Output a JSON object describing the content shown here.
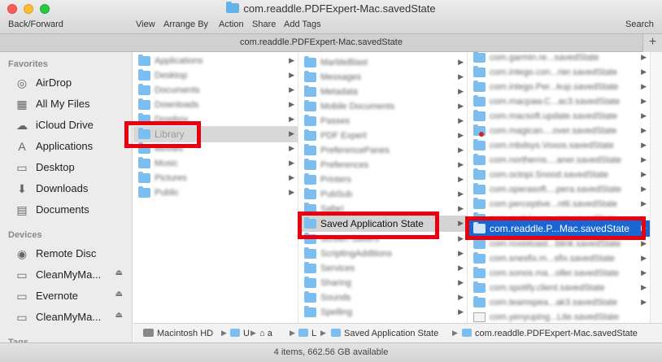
{
  "window": {
    "title": "com.readdle.PDFExpert-Mac.savedState"
  },
  "toolbar": {
    "back_forward": "Back/Forward",
    "view": "View",
    "arrange_by": "Arrange By",
    "action": "Action",
    "share": "Share",
    "add_tags": "Add Tags",
    "search": "Search"
  },
  "tabbar": {
    "title": "com.readdle.PDFExpert-Mac.savedState",
    "plus": "+"
  },
  "sidebar": {
    "favorites_heading": "Favorites",
    "favorites": [
      {
        "label": "AirDrop",
        "icon": "airdrop-icon"
      },
      {
        "label": "All My Files",
        "icon": "all-files-icon"
      },
      {
        "label": "iCloud Drive",
        "icon": "cloud-icon"
      },
      {
        "label": "Applications",
        "icon": "applications-icon"
      },
      {
        "label": "Desktop",
        "icon": "desktop-icon"
      },
      {
        "label": "Downloads",
        "icon": "downloads-icon"
      },
      {
        "label": "Documents",
        "icon": "documents-icon"
      }
    ],
    "devices_heading": "Devices",
    "devices": [
      {
        "label": "Remote Disc",
        "icon": "disc-icon"
      },
      {
        "label": "CleanMyMa...",
        "icon": "drive-icon"
      },
      {
        "label": "Evernote",
        "icon": "drive-icon"
      },
      {
        "label": "CleanMyMa...",
        "icon": "drive-icon"
      }
    ],
    "tags_heading": "Tags"
  },
  "column1": {
    "items": [
      {
        "label": "Applications"
      },
      {
        "label": "Desktop"
      },
      {
        "label": "Documents"
      },
      {
        "label": "Downloads"
      },
      {
        "label": "Dropbox"
      },
      {
        "label": "Library"
      },
      {
        "label": "Movies"
      },
      {
        "label": "Music"
      },
      {
        "label": "Pictures"
      },
      {
        "label": "Public"
      }
    ]
  },
  "column2": {
    "items": [
      {
        "label": "MarbleBlast"
      },
      {
        "label": "Messages"
      },
      {
        "label": "Metadata"
      },
      {
        "label": "Mobile Documents"
      },
      {
        "label": "Passes"
      },
      {
        "label": "PDF Expert"
      },
      {
        "label": "PreferencePanes"
      },
      {
        "label": "Preferences"
      },
      {
        "label": "Printers"
      },
      {
        "label": "PubSub"
      },
      {
        "label": "Safari"
      },
      {
        "label": "Saved Application State"
      },
      {
        "label": "Screen Savers"
      },
      {
        "label": "ScriptingAdditions"
      },
      {
        "label": "Services"
      },
      {
        "label": "Sharing"
      },
      {
        "label": "Sounds"
      },
      {
        "label": "Spelling"
      }
    ]
  },
  "column3": {
    "items": [
      {
        "label": "com.garmin.re...savedState"
      },
      {
        "label": "com.intego.con...rier.savedState"
      },
      {
        "label": "com.intego.Per...kup.savedState"
      },
      {
        "label": "com.macpaw.C...ac3.savedState"
      },
      {
        "label": "com.macsoft.update.savedState"
      },
      {
        "label": "com.magican....over.savedState"
      },
      {
        "label": "com.mbdsys.Voxos.savedState"
      },
      {
        "label": "com.northerns....aner.savedState"
      },
      {
        "label": "com.octopi.Snood.savedState"
      },
      {
        "label": "com.operasoft....pera.savedState"
      },
      {
        "label": "com.perceptive...nt6.savedState"
      },
      {
        "label": "com.realplayer...app.savedState"
      },
      {
        "label": "com.readdle.P...Mac.savedState"
      },
      {
        "label": "com.roxiotoast...blink.savedState"
      },
      {
        "label": "com.snesfix.m...sfix.savedState"
      },
      {
        "label": "com.sonos.ma...oller.savedState"
      },
      {
        "label": "com.spotify.client.savedState"
      },
      {
        "label": "com.teamspea...ak3.savedState"
      },
      {
        "label": "com.yenyuping...Lite.savedState"
      }
    ]
  },
  "pathbar": {
    "items": [
      {
        "label": "Macintosh HD"
      },
      {
        "label": "U"
      },
      {
        "label": "a"
      },
      {
        "label": "L"
      },
      {
        "label": "Saved Application State"
      },
      {
        "label": "com.readdle.PDFExpert-Mac.savedState"
      }
    ]
  },
  "status": {
    "text": "4 items, 662.56 GB available"
  },
  "colors": {
    "selection_blue": "#1a66d2",
    "highlight_red": "#e8000f",
    "folder_blue": "#7cbef0"
  }
}
